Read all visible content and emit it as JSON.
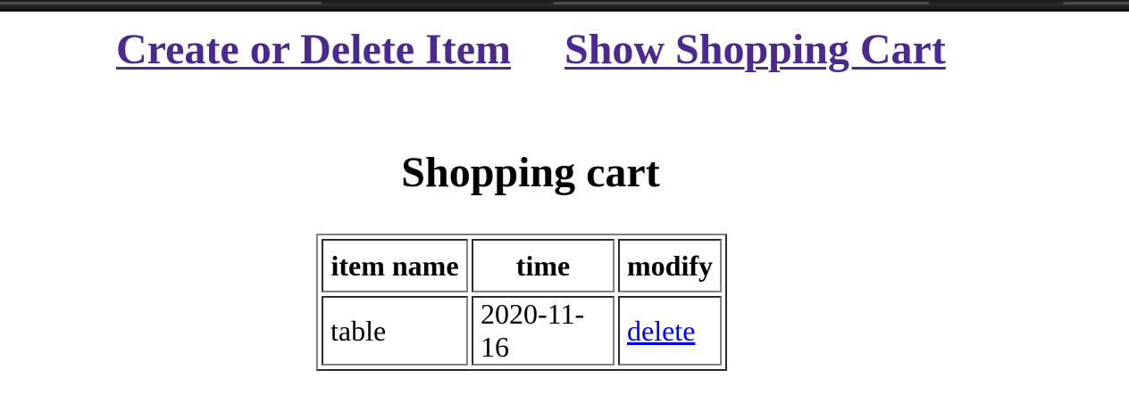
{
  "nav": {
    "create_delete_label": "Create or Delete Item",
    "show_cart_label": "Show Shopping Cart"
  },
  "page": {
    "title": "Shopping cart"
  },
  "cart_table": {
    "headers": [
      "item name",
      "time",
      "modify"
    ],
    "rows": [
      {
        "item_name": "table",
        "time": "2020-11-16",
        "action_label": "delete"
      }
    ]
  },
  "colors": {
    "visited_link": "#4b2a8c",
    "link": "#0000ee"
  }
}
